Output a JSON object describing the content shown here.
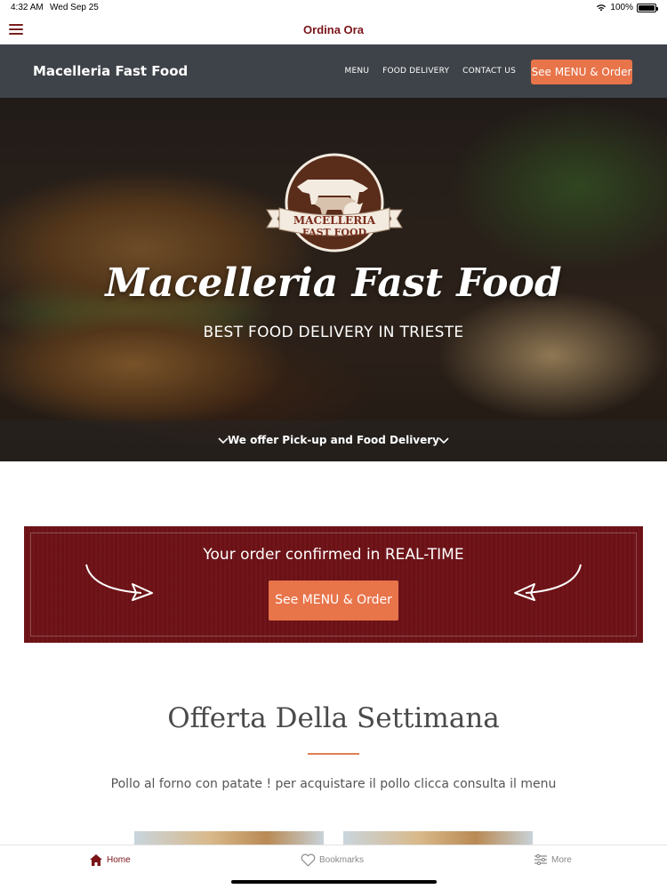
{
  "status_bar": {
    "time": "4:32 AM",
    "date": "Wed Sep 25",
    "battery": "100%"
  },
  "app_bar": {
    "title": "Ordina Ora"
  },
  "site_nav": {
    "brand": "Macelleria Fast Food",
    "links": [
      "MENU",
      "FOOD DELIVERY",
      "CONTACT US"
    ],
    "cta": "See MENU & Order"
  },
  "hero": {
    "logo_text_line1": "MACELLERIA",
    "logo_text_line2": "FAST FOOD",
    "title": "Macelleria Fast Food",
    "subtitle": "BEST FOOD DELIVERY IN TRIESTE",
    "band_text": "We offer Pick-up and Food Delivery"
  },
  "order_banner": {
    "title": "Your order confirmed in REAL-TIME",
    "button": "See MENU & Order"
  },
  "offer": {
    "title": "Offerta Della Settimana",
    "description": "Pollo al forno con patate ! per acquistare il pollo clicca consulta il menu"
  },
  "tab_bar": {
    "home": "Home",
    "bookmarks": "Bookmarks",
    "more": "More"
  },
  "colors": {
    "accent": "#e8744a",
    "brand_red": "#7a1419",
    "banner": "#6e1217",
    "nav": "#3e4349"
  }
}
